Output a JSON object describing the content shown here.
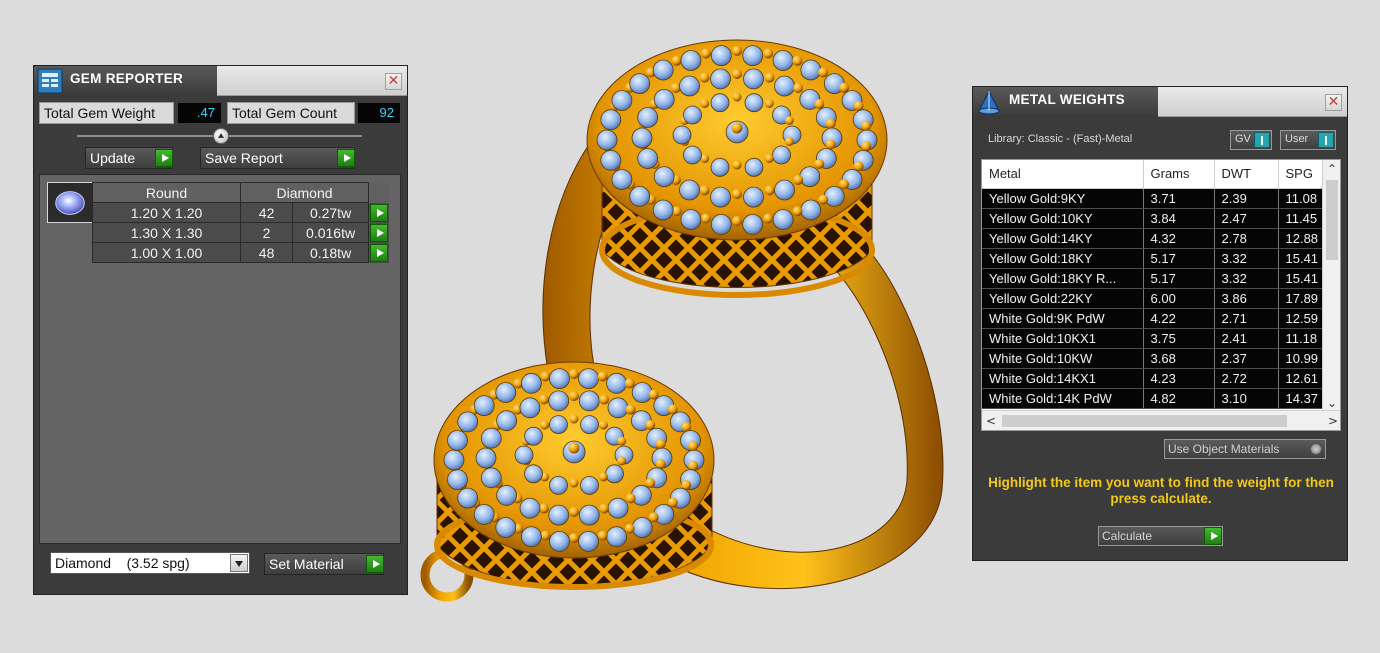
{
  "gem_reporter": {
    "title": "GEM REPORTER",
    "close_glyph": "✕",
    "total_weight_label": "Total Gem Weight",
    "total_weight_value": ".47",
    "total_count_label": "Total Gem Count",
    "total_count_value": "92",
    "update_label": "Update",
    "save_report_label": "Save Report",
    "table_headers": [
      "Round",
      "Diamond"
    ],
    "rows": [
      {
        "size": "1.20 X 1.20",
        "count": "42",
        "weight": "0.27tw"
      },
      {
        "size": "1.30 X 1.30",
        "count": "2",
        "weight": "0.016tw"
      },
      {
        "size": "1.00 X 1.00",
        "count": "48",
        "weight": "0.18tw"
      }
    ],
    "material_select": "Diamond    (3.52 spg)",
    "set_material_label": "Set Material"
  },
  "metal_weights": {
    "title": "METAL WEIGHTS",
    "close_glyph": "✕",
    "library_label": "Library: Classic - (Fast)-Metal",
    "toggle_gv": "GV",
    "toggle_user": "User",
    "columns": [
      "Metal",
      "Grams",
      "DWT",
      "SPG"
    ],
    "rows": [
      {
        "metal": "Yellow Gold:9KY",
        "grams": "3.71",
        "dwt": "2.39",
        "spg": "11.08"
      },
      {
        "metal": "Yellow Gold:10KY",
        "grams": "3.84",
        "dwt": "2.47",
        "spg": "11.45"
      },
      {
        "metal": "Yellow Gold:14KY",
        "grams": "4.32",
        "dwt": "2.78",
        "spg": "12.88"
      },
      {
        "metal": "Yellow Gold:18KY",
        "grams": "5.17",
        "dwt": "3.32",
        "spg": "15.41"
      },
      {
        "metal": "Yellow Gold:18KY R...",
        "grams": "5.17",
        "dwt": "3.32",
        "spg": "15.41"
      },
      {
        "metal": "Yellow Gold:22KY",
        "grams": "6.00",
        "dwt": "3.86",
        "spg": "17.89"
      },
      {
        "metal": "White Gold:9K PdW",
        "grams": "4.22",
        "dwt": "2.71",
        "spg": "12.59"
      },
      {
        "metal": "White Gold:10KX1",
        "grams": "3.75",
        "dwt": "2.41",
        "spg": "11.18"
      },
      {
        "metal": "White Gold:10KW",
        "grams": "3.68",
        "dwt": "2.37",
        "spg": "10.99"
      },
      {
        "metal": "White Gold:14KX1",
        "grams": "4.23",
        "dwt": "2.72",
        "spg": "12.61"
      },
      {
        "metal": "White Gold:14K PdW",
        "grams": "4.82",
        "dwt": "3.10",
        "spg": "14.37"
      }
    ],
    "scroll_up": "⌃",
    "scroll_down": "⌄",
    "scroll_left": "<",
    "scroll_right": ">",
    "use_object_materials_label": "Use Object Materials",
    "hint_text": "Highlight the item you want to find the weight for then press calculate.",
    "calculate_label": "Calculate"
  },
  "colors": {
    "panel_bg": "#3b3b3b",
    "value_cyan": "#2fd8ff",
    "hint_yellow": "#f2c916",
    "go_green": "#2f9d1c",
    "gold": "#e8a000",
    "gem_blue": "#8fb4e8"
  },
  "icons": [
    "gem-reporter-app-icon",
    "metal-weights-app-icon",
    "close-icon",
    "slider-knob-icon",
    "play-arrow-icon",
    "dropdown-arrow-icon",
    "gem-thumbnail-icon"
  ]
}
